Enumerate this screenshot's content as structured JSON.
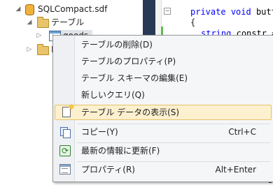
{
  "tree": {
    "db_name": "SQLCompact.sdf",
    "tables_folder": "テーブル",
    "table_item": "goods",
    "second_folder_partial": "L"
  },
  "code": {
    "line1_kw1": "private",
    "line1_kw2": "void",
    "line1_rest": "butt",
    "line2": "{",
    "line3_kw": "string",
    "line3_rest": "constr =",
    "trunc_chars": [
      "c",
      "c",
      "e",
      "e",
      "e",
      "e",
      "e"
    ]
  },
  "context_menu": {
    "items": [
      {
        "label": "テーブルの削除(D)",
        "shortcut": ""
      },
      {
        "label": "テーブルのプロパティ(P)",
        "shortcut": ""
      },
      {
        "label": "テーブル スキーマの編集(E)",
        "shortcut": ""
      },
      {
        "label": "新しいクエリ(Q)",
        "shortcut": ""
      },
      {
        "label": "テーブル データの表示(S)",
        "shortcut": "",
        "highlighted": true
      },
      {
        "label": "コピー(Y)",
        "shortcut": "Ctrl+C"
      },
      {
        "label": "最新の情報に更新(F)",
        "shortcut": ""
      },
      {
        "label": "プロパティ(R)",
        "shortcut": "Alt+Enter"
      }
    ]
  },
  "colors": {
    "highlight_bg": "#fdf0cf",
    "highlight_border": "#e5c365",
    "keyword_blue": "#0000ff",
    "gutter_dark": "#293955"
  }
}
